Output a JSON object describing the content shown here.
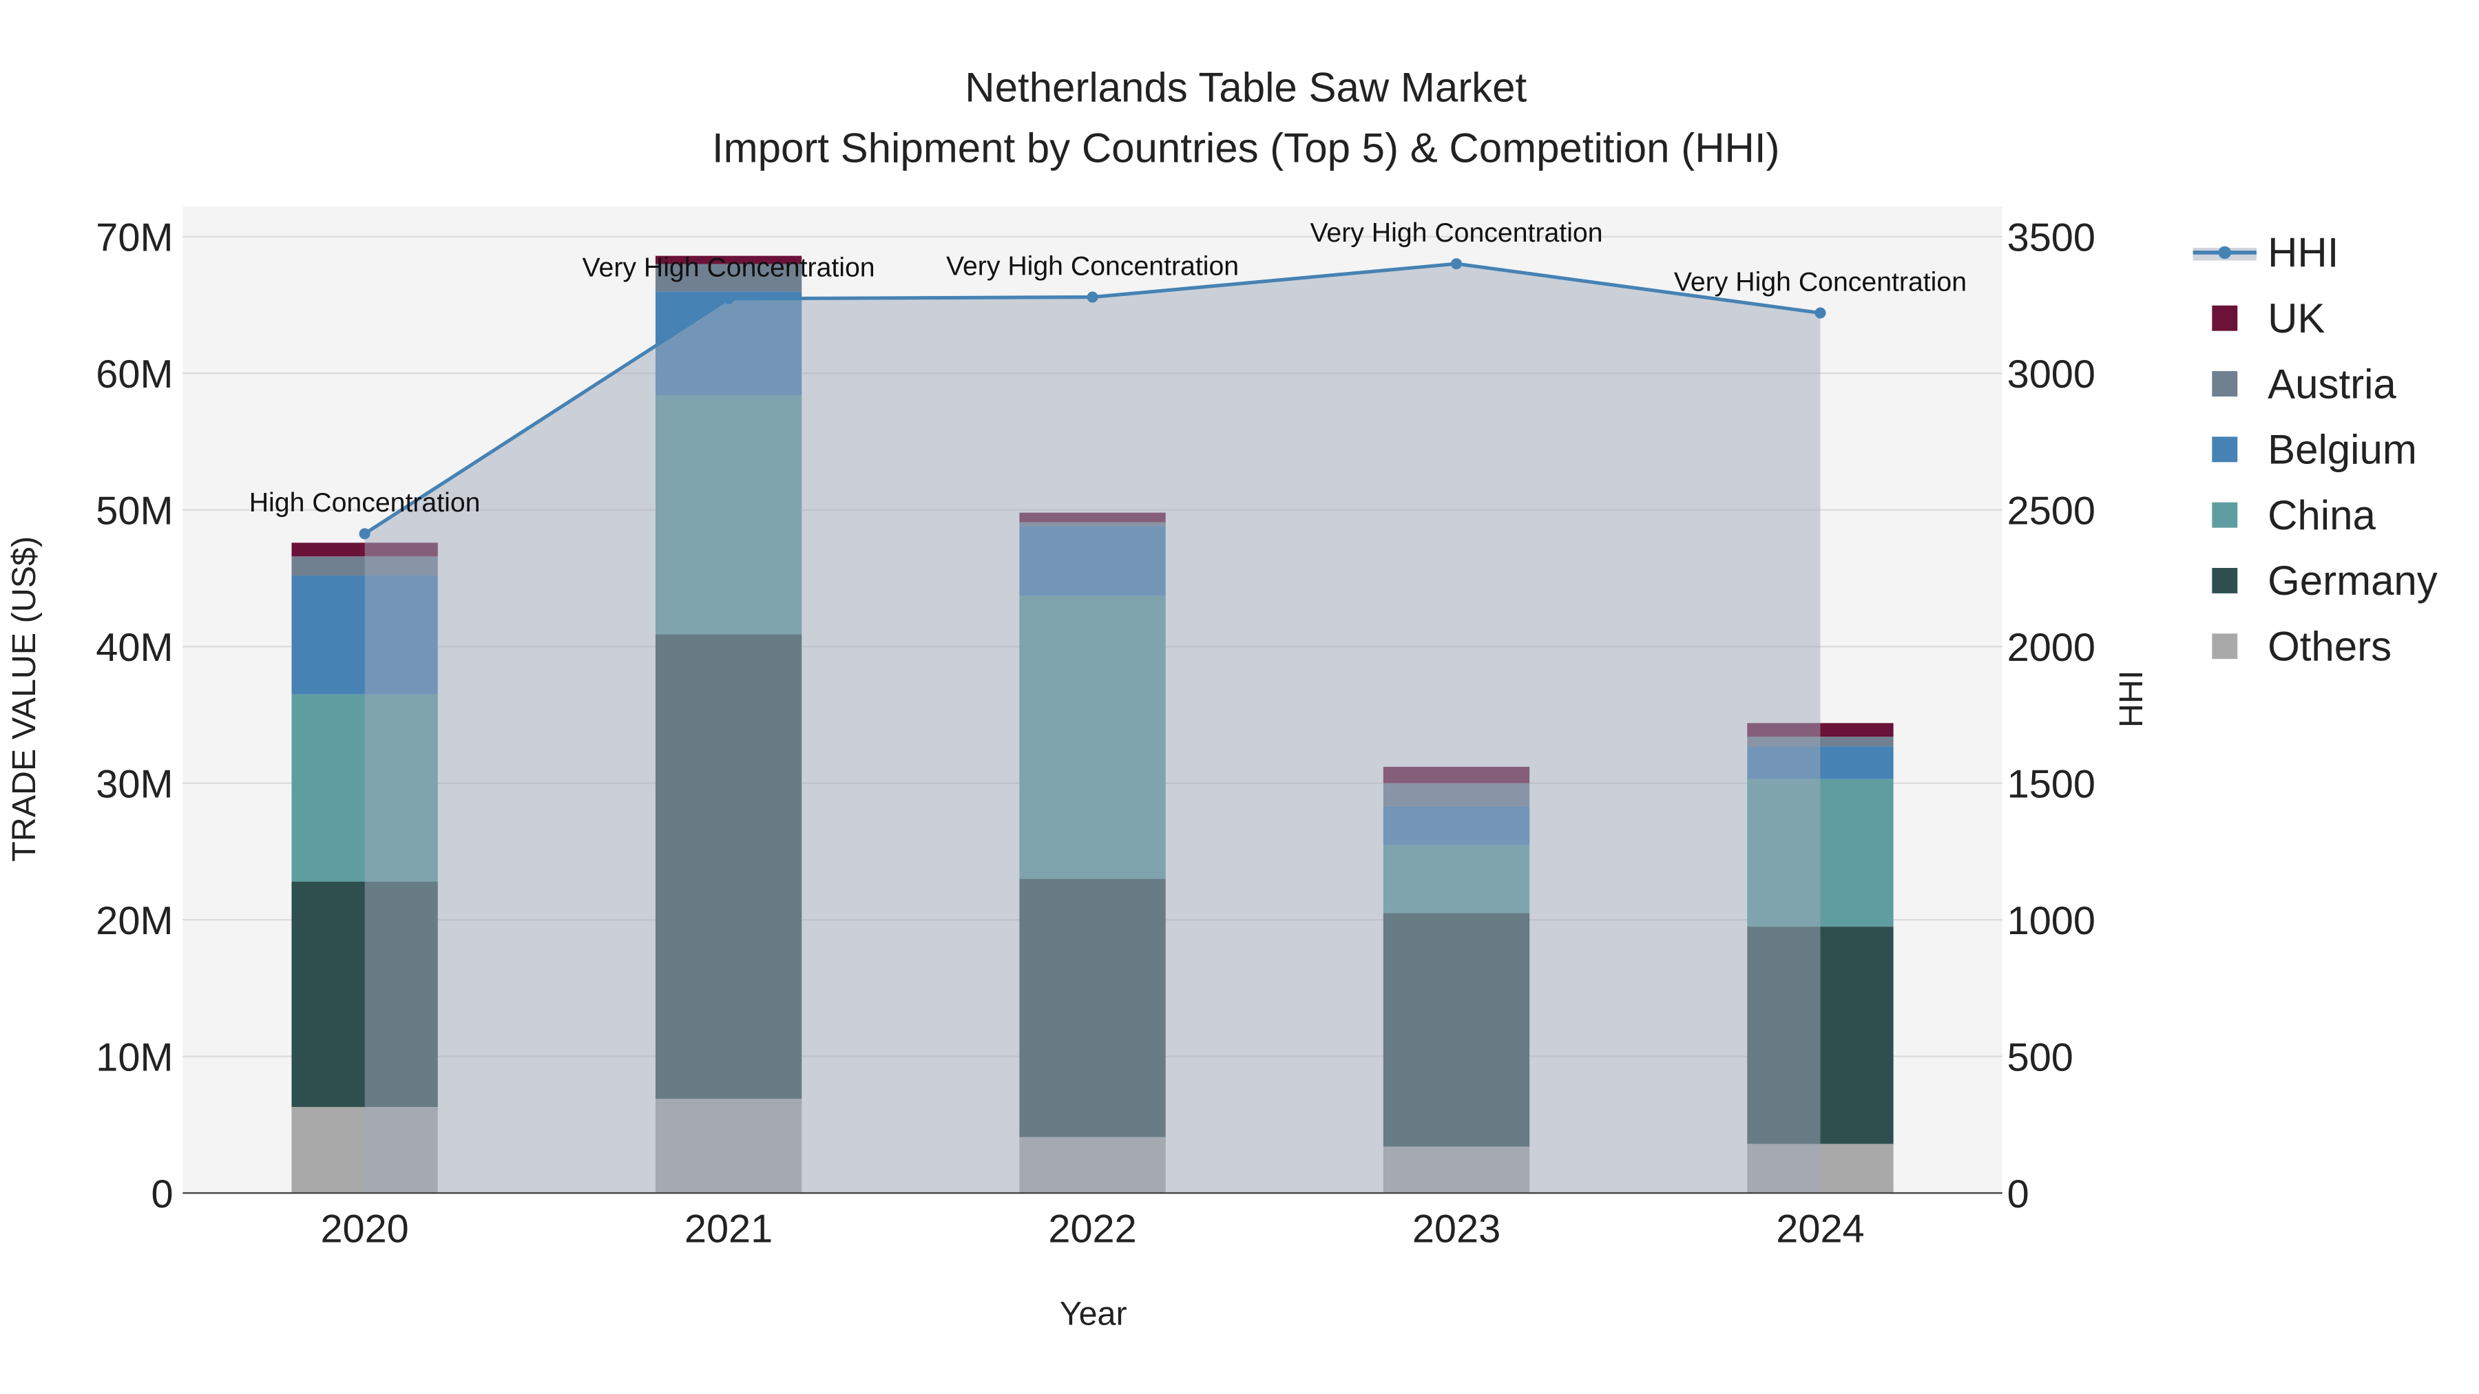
{
  "chart_data": {
    "type": "bar",
    "title": "Netherlands Table Saw Market",
    "subtitle": "Import Shipment by Countries (Top 5) & Competition (HHI)",
    "xlabel": "Year",
    "ylabel": "TRADE VALUE (US$)",
    "y2label": "HHI",
    "categories": [
      "2020",
      "2021",
      "2022",
      "2023",
      "2024"
    ],
    "ylim": [
      0,
      70000000
    ],
    "y_ticks": [
      0,
      10000000,
      20000000,
      30000000,
      40000000,
      50000000,
      60000000,
      70000000
    ],
    "y_tick_labels": [
      "0",
      "10M",
      "20M",
      "30M",
      "40M",
      "50M",
      "60M",
      "70M"
    ],
    "y2lim": [
      0,
      3500
    ],
    "y2_ticks": [
      0,
      500,
      1000,
      1500,
      2000,
      2500,
      3000,
      3500
    ],
    "y2_tick_labels": [
      "0",
      "500",
      "1000",
      "1500",
      "2000",
      "2500",
      "3000",
      "3500"
    ],
    "grid": true,
    "legend_position": "right",
    "series": [
      {
        "name": "Others",
        "color": "#a9a9a9",
        "values": [
          6300000,
          6900000,
          4100000,
          3400000,
          3600000
        ]
      },
      {
        "name": "Germany",
        "color": "#2f4f4f",
        "values": [
          16500000,
          34000000,
          18900000,
          17100000,
          15900000
        ]
      },
      {
        "name": "China",
        "color": "#5f9ea0",
        "values": [
          13700000,
          17500000,
          20700000,
          5000000,
          10800000
        ]
      },
      {
        "name": "Belgium",
        "color": "#4682b4",
        "values": [
          8700000,
          7600000,
          5100000,
          2800000,
          2400000
        ]
      },
      {
        "name": "Austria",
        "color": "#708090",
        "values": [
          1400000,
          2000000,
          300000,
          1700000,
          700000
        ]
      },
      {
        "name": "UK",
        "color": "#6b1238",
        "values": [
          1000000,
          600000,
          700000,
          1200000,
          1000000
        ]
      }
    ],
    "hhi": {
      "name": "HHI",
      "color": "#4682b4",
      "values": [
        2413,
        3273,
        3279,
        3401,
        3221
      ],
      "annotations": [
        "High Concentration",
        "Very High Concentration",
        "Very High Concentration",
        "Very High Concentration",
        "Very High Concentration"
      ]
    },
    "legend": [
      "HHI",
      "UK",
      "Austria",
      "Belgium",
      "China",
      "Germany",
      "Others"
    ]
  }
}
